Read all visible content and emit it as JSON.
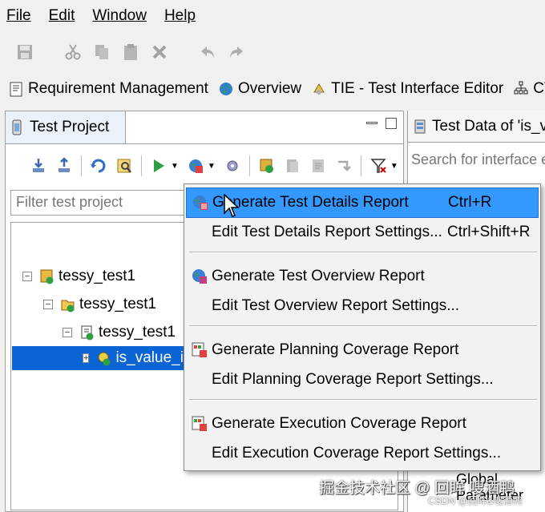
{
  "menubar": {
    "items": [
      {
        "label": "File"
      },
      {
        "label": "Edit"
      },
      {
        "label": "Window"
      },
      {
        "label": "Help"
      }
    ]
  },
  "toolbar": {
    "icons": [
      "save-icon",
      "cut-icon",
      "copy-icon",
      "paste-icon",
      "delete-icon",
      "undo-icon",
      "redo-icon"
    ]
  },
  "perspectives": [
    {
      "label": "Requirement Management",
      "icon": "requirement-icon"
    },
    {
      "label": "Overview",
      "icon": "globe-icon"
    },
    {
      "label": "TIE - Test Interface Editor",
      "icon": "tie-icon"
    },
    {
      "label": "CTE - Classifica",
      "icon": "cte-icon"
    }
  ],
  "left_view": {
    "tab_label": "Test Project",
    "filter_placeholder": "Filter test project",
    "tree": [
      {
        "label": "tessy_test1",
        "level": 0,
        "expander": "−"
      },
      {
        "label": "tessy_test1",
        "level": 1,
        "expander": "−"
      },
      {
        "label": "tessy_test1",
        "level": 2,
        "expander": "−"
      },
      {
        "label": "is_value_in_",
        "level": 3,
        "expander": "+",
        "selected": true
      }
    ]
  },
  "right_view": {
    "tab_label": "Test Data of 'is_value",
    "search_placeholder": "Search for interface elem",
    "bottom_text_1": "Global",
    "bottom_text_2": "Parameter"
  },
  "context_menu": {
    "items": [
      {
        "label": "Generate Test Details Report",
        "shortcut": "Ctrl+R",
        "icon": "report-icon",
        "highlighted": true
      },
      {
        "label": "Edit Test Details Report Settings...",
        "shortcut": "Ctrl+Shift+R",
        "icon": ""
      },
      {
        "label": "Generate Test Overview Report",
        "shortcut": "",
        "icon": "overview-report-icon"
      },
      {
        "label": "Edit Test Overview Report Settings...",
        "shortcut": "",
        "icon": ""
      },
      {
        "label": "Generate Planning Coverage Report",
        "shortcut": "",
        "icon": "planning-coverage-icon"
      },
      {
        "label": "Edit Planning Coverage Report Settings...",
        "shortcut": "",
        "icon": ""
      },
      {
        "label": "Generate Execution Coverage Report",
        "shortcut": "",
        "icon": "execution-coverage-icon"
      },
      {
        "label": "Edit Execution Coverage Report Settings...",
        "shortcut": "",
        "icon": ""
      }
    ]
  },
  "watermark": {
    "text": "掘金技术社区 @ 回眸 嗖酒鸭",
    "sub": "CSDN @回眸&嗖酒鸭"
  },
  "colors": {
    "selection": "#0a64d4",
    "menu_highlight": "#3399ff",
    "background": "#f0f0f0"
  }
}
